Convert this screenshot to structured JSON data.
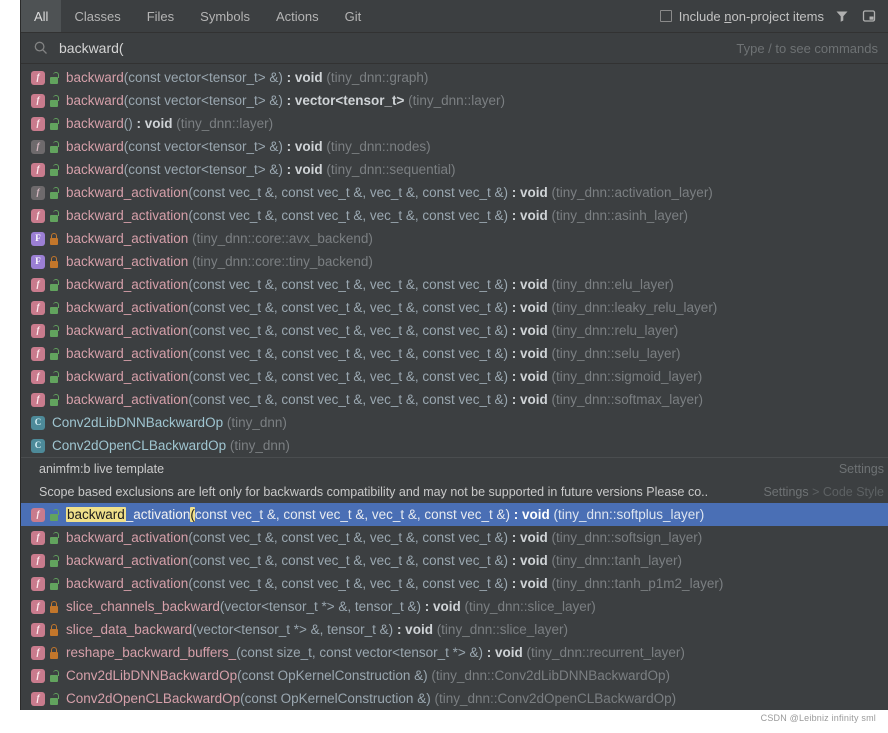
{
  "tabs": [
    {
      "label": "All",
      "selected": true
    },
    {
      "label": "Classes",
      "selected": false
    },
    {
      "label": "Files",
      "selected": false
    },
    {
      "label": "Symbols",
      "selected": false
    },
    {
      "label": "Actions",
      "selected": false
    },
    {
      "label": "Git",
      "selected": false
    }
  ],
  "toolbar": {
    "include_non_project_pre": "Include ",
    "include_non_project_mnemonic": "n",
    "include_non_project_post": "on-project items",
    "include_non_project_checked": false,
    "filter_icon": "filter-funnel-icon",
    "window_icon": "pin-window-icon"
  },
  "search": {
    "icon": "search-icon",
    "value": "backward(",
    "hint": "Type / to see commands"
  },
  "colors": {
    "dialog_bg": "#3c3f41",
    "selection_bg": "#4a6fb5",
    "highlight_bg": "#f0e08a",
    "fn_badge": "#c97b8d",
    "field_badge": "#9b7fd4",
    "class_badge": "#4d8a99",
    "lock_open": "#62a35e",
    "lock_closed": "#c2762b",
    "namespace_text": "#7b7f82"
  },
  "rows": [
    {
      "kind": "symbol",
      "badge": "fn",
      "lock": "open",
      "name": "backward",
      "sig": "(const vector<tensor_t> &)",
      "ret": " : void",
      "ns": "(tiny_dnn::graph)"
    },
    {
      "kind": "symbol",
      "badge": "fn",
      "lock": "open",
      "name": "backward",
      "sig": "(const vector<tensor_t> &)",
      "ret": " : vector<tensor_t>",
      "ns": "(tiny_dnn::layer)"
    },
    {
      "kind": "symbol",
      "badge": "fn",
      "lock": "open",
      "name": "backward",
      "sig": "()",
      "ret": " : void",
      "ns": "(tiny_dnn::layer)"
    },
    {
      "kind": "symbol",
      "badge": "fn-virtual",
      "lock": "open",
      "name": "backward",
      "sig": "(const vector<tensor_t> &)",
      "ret": " : void",
      "ns": "(tiny_dnn::nodes)"
    },
    {
      "kind": "symbol",
      "badge": "fn",
      "lock": "open",
      "name": "backward",
      "sig": "(const vector<tensor_t> &)",
      "ret": " : void",
      "ns": "(tiny_dnn::sequential)"
    },
    {
      "kind": "symbol",
      "badge": "fn-virtual",
      "lock": "open",
      "name": "backward_activation",
      "sig": "(const vec_t &, const vec_t &, vec_t &, const vec_t &)",
      "ret": " : void",
      "ns": "(tiny_dnn::activation_layer)"
    },
    {
      "kind": "symbol",
      "badge": "fn",
      "lock": "open",
      "name": "backward_activation",
      "sig": "(const vec_t &, const vec_t &, vec_t &, const vec_t &)",
      "ret": " : void",
      "ns": "(tiny_dnn::asinh_layer)"
    },
    {
      "kind": "symbol",
      "badge": "field",
      "lock": "closed",
      "name": "backward_activation",
      "sig": "",
      "ret": "",
      "ns": "(tiny_dnn::core::avx_backend)"
    },
    {
      "kind": "symbol",
      "badge": "field",
      "lock": "closed",
      "name": "backward_activation",
      "sig": "",
      "ret": "",
      "ns": "(tiny_dnn::core::tiny_backend)"
    },
    {
      "kind": "symbol",
      "badge": "fn",
      "lock": "open",
      "name": "backward_activation",
      "sig": "(const vec_t &, const vec_t &, vec_t &, const vec_t &)",
      "ret": " : void",
      "ns": "(tiny_dnn::elu_layer)"
    },
    {
      "kind": "symbol",
      "badge": "fn",
      "lock": "open",
      "name": "backward_activation",
      "sig": "(const vec_t &, const vec_t &, vec_t &, const vec_t &)",
      "ret": " : void",
      "ns": "(tiny_dnn::leaky_relu_layer)"
    },
    {
      "kind": "symbol",
      "badge": "fn",
      "lock": "open",
      "name": "backward_activation",
      "sig": "(const vec_t &, const vec_t &, vec_t &, const vec_t &)",
      "ret": " : void",
      "ns": "(tiny_dnn::relu_layer)"
    },
    {
      "kind": "symbol",
      "badge": "fn",
      "lock": "open",
      "name": "backward_activation",
      "sig": "(const vec_t &, const vec_t &, vec_t &, const vec_t &)",
      "ret": " : void",
      "ns": "(tiny_dnn::selu_layer)"
    },
    {
      "kind": "symbol",
      "badge": "fn",
      "lock": "open",
      "name": "backward_activation",
      "sig": "(const vec_t &, const vec_t &, vec_t &, const vec_t &)",
      "ret": " : void",
      "ns": "(tiny_dnn::sigmoid_layer)"
    },
    {
      "kind": "symbol",
      "badge": "fn",
      "lock": "open",
      "name": "backward_activation",
      "sig": "(const vec_t &, const vec_t &, vec_t &, const vec_t &)",
      "ret": " : void",
      "ns": "(tiny_dnn::softmax_layer)"
    },
    {
      "kind": "class",
      "badge": "cls",
      "lock": null,
      "name": "Conv2dLibDNNBackwardOp",
      "sig": "",
      "ret": "",
      "ns": "(tiny_dnn)"
    },
    {
      "kind": "class",
      "badge": "cls",
      "lock": null,
      "name": "Conv2dOpenCLBackwardOp",
      "sig": "",
      "ret": "",
      "ns": "(tiny_dnn)"
    },
    {
      "kind": "meta",
      "separator": true,
      "left": "animfm:b live template",
      "right": "Settings",
      "right_tail": ""
    },
    {
      "kind": "meta",
      "separator": false,
      "left": "Scope based exclusions are left only for backwards compatibility and may not be supported in future versions Please co..",
      "right": "Settings",
      "right_tail": " > Code Style"
    },
    {
      "kind": "symbol",
      "selected": true,
      "badge": "fn",
      "lock": "open",
      "highlight": "backward",
      "name_rest": "_activation",
      "paren_hl": "(",
      "sig": "const vec_t &, const vec_t &, vec_t &, const vec_t &)",
      "ret": " : void",
      "ns": "(tiny_dnn::softplus_layer)"
    },
    {
      "kind": "symbol",
      "badge": "fn",
      "lock": "open",
      "name": "backward_activation",
      "sig": "(const vec_t &, const vec_t &, vec_t &, const vec_t &)",
      "ret": " : void",
      "ns": "(tiny_dnn::softsign_layer)"
    },
    {
      "kind": "symbol",
      "badge": "fn",
      "lock": "open",
      "name": "backward_activation",
      "sig": "(const vec_t &, const vec_t &, vec_t &, const vec_t &)",
      "ret": " : void",
      "ns": "(tiny_dnn::tanh_layer)"
    },
    {
      "kind": "symbol",
      "badge": "fn",
      "lock": "open",
      "name": "backward_activation",
      "sig": "(const vec_t &, const vec_t &, vec_t &, const vec_t &)",
      "ret": " : void",
      "ns": "(tiny_dnn::tanh_p1m2_layer)"
    },
    {
      "kind": "symbol",
      "badge": "fn",
      "lock": "closed",
      "name": "slice_channels_backward",
      "sig": "(vector<tensor_t *> &, tensor_t &)",
      "ret": " : void",
      "ns": "(tiny_dnn::slice_layer)"
    },
    {
      "kind": "symbol",
      "badge": "fn",
      "lock": "closed",
      "name": "slice_data_backward",
      "sig": "(vector<tensor_t *> &, tensor_t &)",
      "ret": " : void",
      "ns": "(tiny_dnn::slice_layer)"
    },
    {
      "kind": "symbol",
      "badge": "fn",
      "lock": "closed",
      "name": "reshape_backward_buffers_",
      "sig": "(const size_t, const vector<tensor_t *> &)",
      "ret": " : void",
      "ns": "(tiny_dnn::recurrent_layer)"
    },
    {
      "kind": "symbol",
      "badge": "fn",
      "lock": "open",
      "name": "Conv2dLibDNNBackwardOp",
      "sig": "(const OpKernelConstruction &)",
      "ret": "",
      "ns": "(tiny_dnn::Conv2dLibDNNBackwardOp)"
    },
    {
      "kind": "symbol",
      "badge": "fn",
      "lock": "open",
      "name": "Conv2dOpenCLBackwardOp",
      "sig": "(const OpKernelConstruction &)",
      "ret": "",
      "ns": "(tiny_dnn::Conv2dOpenCLBackwardOp)"
    }
  ],
  "watermark": "CSDN @Leibniz infinity sml"
}
